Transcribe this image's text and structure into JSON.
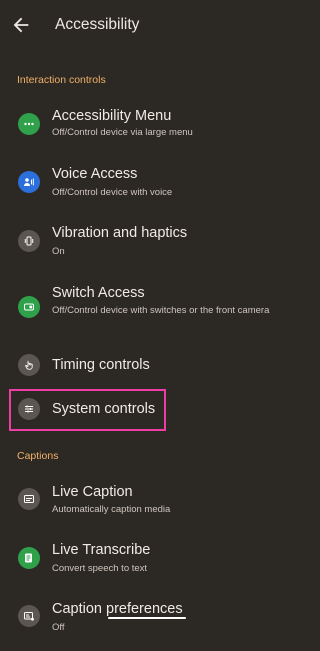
{
  "header": {
    "title": "Accessibility"
  },
  "sections": {
    "interaction_title": "Interaction controls",
    "captions_title": "Captions"
  },
  "items": {
    "accessibility_menu": {
      "label": "Accessibility Menu",
      "sub": "Off/Control device via large menu"
    },
    "voice_access": {
      "label": "Voice Access",
      "sub": "Off/Control device with voice"
    },
    "vibration": {
      "label": "Vibration and haptics",
      "sub": "On"
    },
    "switch_access": {
      "label": "Switch Access",
      "sub": "Off/Control device with switches or the front camera"
    },
    "timing": {
      "label": "Timing controls"
    },
    "system_controls": {
      "label": "System controls"
    },
    "live_caption": {
      "label": "Live Caption",
      "sub": "Automatically caption media"
    },
    "live_transcribe": {
      "label": "Live Transcribe",
      "sub": "Convert speech to text"
    },
    "caption_prefs": {
      "label": "Caption preferences",
      "sub": "Off"
    }
  },
  "colors": {
    "background": "#2c2824",
    "section_accent": "#f2b168",
    "icon_green": "#2fa14a",
    "icon_blue": "#2a6fdb",
    "icon_gray": "#5b5650",
    "highlight": "#ee3ea6"
  },
  "icons": {
    "back": "arrow-left-icon",
    "accessibility_menu": "menu-dots-icon",
    "voice_access": "voice-access-icon",
    "vibration": "vibration-icon",
    "switch_access": "switch-access-icon",
    "timing": "touch-hand-icon",
    "system_controls": "sliders-icon",
    "live_caption": "caption-icon",
    "live_transcribe": "transcribe-icon",
    "caption_prefs": "caption-settings-icon"
  }
}
